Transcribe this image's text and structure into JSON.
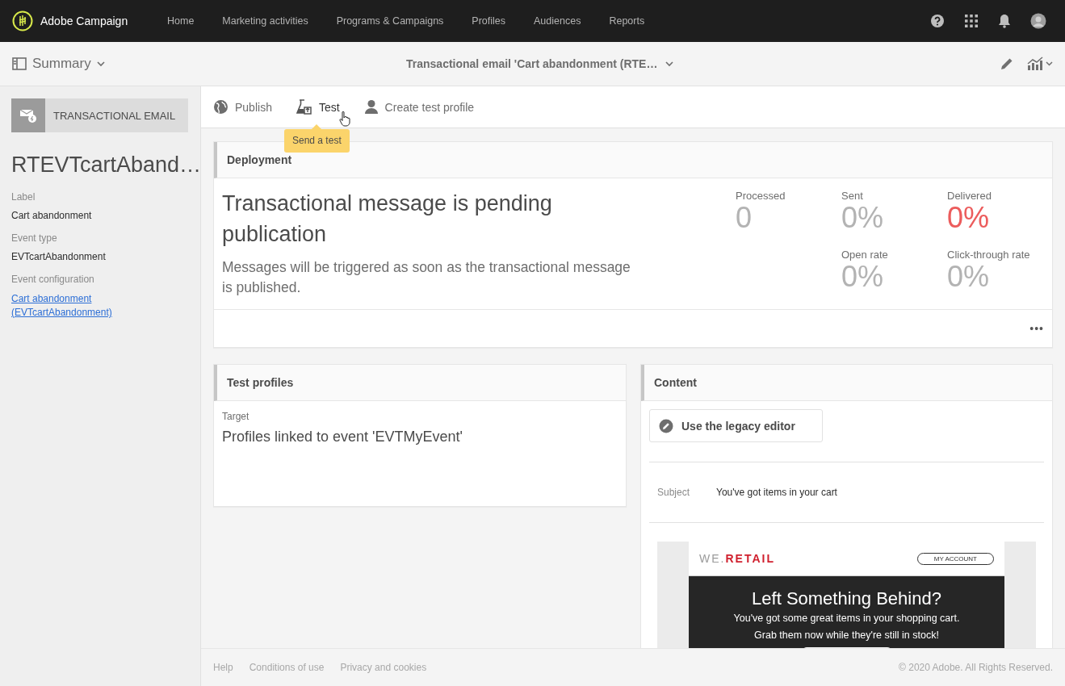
{
  "app": {
    "name": "Adobe Campaign"
  },
  "nav": [
    {
      "label": "Home",
      "selected": false
    },
    {
      "label": "Marketing activities",
      "selected": false
    },
    {
      "label": "Programs & Campaigns",
      "selected": false
    },
    {
      "label": "Profiles",
      "selected": false
    },
    {
      "label": "Audiences",
      "selected": false
    },
    {
      "label": "Reports",
      "selected": false
    }
  ],
  "subheader": {
    "view": "Summary",
    "title": "Transactional email 'Cart abandonment (RTE…"
  },
  "sidebar": {
    "type_label": "TRANSACTIONAL EMAIL",
    "name": "RTEVTcartAband…",
    "fields": [
      {
        "label": "Label",
        "value": "Cart abandonment",
        "kind": "text"
      },
      {
        "label": "Event type",
        "value": "EVTcartAbandonment",
        "kind": "text"
      },
      {
        "label": "Event configuration",
        "value": "Cart abandonment (EVTcartAbandonment)",
        "kind": "link"
      }
    ]
  },
  "toolbar": [
    {
      "label": "Publish",
      "kind": "globe"
    },
    {
      "label": "Test",
      "kind": "flask"
    },
    {
      "label": "Create test profile",
      "kind": "person"
    }
  ],
  "tooltip": "Send a test",
  "deployment": {
    "title": "Deployment",
    "heading": "Transactional message is pending publication",
    "message": "Messages will be triggered as soon as the transactional message is published.",
    "more": "•••",
    "stats": [
      {
        "label": "Processed",
        "value": "0",
        "color": "#b3b3b3"
      },
      {
        "label": "Sent",
        "value": "0%",
        "color": "#b3b3b3"
      },
      {
        "label": "Delivered",
        "value": "0%",
        "color": "#ec5c5c"
      },
      {
        "label": "Open rate",
        "value": "0%",
        "color": "#b3b3b3"
      },
      {
        "label": "Click-through rate",
        "value": "0%",
        "color": "#b3b3b3"
      }
    ]
  },
  "test_profiles": {
    "title": "Test profiles",
    "target_label": "Target",
    "target": "Profiles linked to event 'EVTMyEvent'"
  },
  "content": {
    "title": "Content",
    "editor_button": "Use the legacy editor",
    "subject_label": "Subject",
    "subject": "You've got items in your cart",
    "email": {
      "brand_prefix": "WE.",
      "brand": "RETAIL",
      "account_button": "MY ACCOUNT",
      "headline": "Left Something Behind?",
      "lines": [
        "You've got some great items in your shopping cart.",
        "Grab them now while they're still in stock!"
      ]
    }
  },
  "footer": {
    "links": [
      "Help",
      "Conditions of use",
      "Privacy and cookies"
    ],
    "copyright": "© 2020 Adobe. All Rights Reserved."
  }
}
